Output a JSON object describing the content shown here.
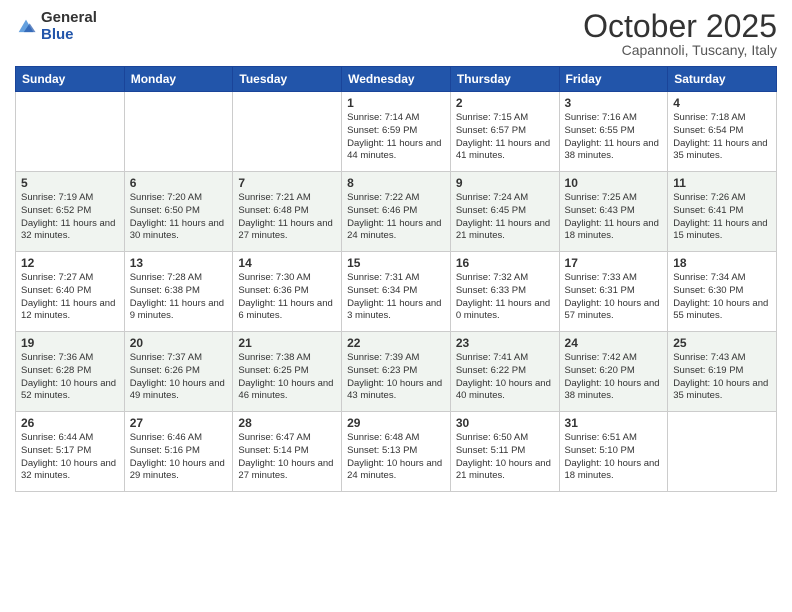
{
  "header": {
    "logo_general": "General",
    "logo_blue": "Blue",
    "month": "October 2025",
    "location": "Capannoli, Tuscany, Italy"
  },
  "weekdays": [
    "Sunday",
    "Monday",
    "Tuesday",
    "Wednesday",
    "Thursday",
    "Friday",
    "Saturday"
  ],
  "weeks": [
    {
      "shaded": false,
      "days": [
        {
          "num": "",
          "info": ""
        },
        {
          "num": "",
          "info": ""
        },
        {
          "num": "",
          "info": ""
        },
        {
          "num": "1",
          "info": "Sunrise: 7:14 AM\nSunset: 6:59 PM\nDaylight: 11 hours\nand 44 minutes."
        },
        {
          "num": "2",
          "info": "Sunrise: 7:15 AM\nSunset: 6:57 PM\nDaylight: 11 hours\nand 41 minutes."
        },
        {
          "num": "3",
          "info": "Sunrise: 7:16 AM\nSunset: 6:55 PM\nDaylight: 11 hours\nand 38 minutes."
        },
        {
          "num": "4",
          "info": "Sunrise: 7:18 AM\nSunset: 6:54 PM\nDaylight: 11 hours\nand 35 minutes."
        }
      ]
    },
    {
      "shaded": true,
      "days": [
        {
          "num": "5",
          "info": "Sunrise: 7:19 AM\nSunset: 6:52 PM\nDaylight: 11 hours\nand 32 minutes."
        },
        {
          "num": "6",
          "info": "Sunrise: 7:20 AM\nSunset: 6:50 PM\nDaylight: 11 hours\nand 30 minutes."
        },
        {
          "num": "7",
          "info": "Sunrise: 7:21 AM\nSunset: 6:48 PM\nDaylight: 11 hours\nand 27 minutes."
        },
        {
          "num": "8",
          "info": "Sunrise: 7:22 AM\nSunset: 6:46 PM\nDaylight: 11 hours\nand 24 minutes."
        },
        {
          "num": "9",
          "info": "Sunrise: 7:24 AM\nSunset: 6:45 PM\nDaylight: 11 hours\nand 21 minutes."
        },
        {
          "num": "10",
          "info": "Sunrise: 7:25 AM\nSunset: 6:43 PM\nDaylight: 11 hours\nand 18 minutes."
        },
        {
          "num": "11",
          "info": "Sunrise: 7:26 AM\nSunset: 6:41 PM\nDaylight: 11 hours\nand 15 minutes."
        }
      ]
    },
    {
      "shaded": false,
      "days": [
        {
          "num": "12",
          "info": "Sunrise: 7:27 AM\nSunset: 6:40 PM\nDaylight: 11 hours\nand 12 minutes."
        },
        {
          "num": "13",
          "info": "Sunrise: 7:28 AM\nSunset: 6:38 PM\nDaylight: 11 hours\nand 9 minutes."
        },
        {
          "num": "14",
          "info": "Sunrise: 7:30 AM\nSunset: 6:36 PM\nDaylight: 11 hours\nand 6 minutes."
        },
        {
          "num": "15",
          "info": "Sunrise: 7:31 AM\nSunset: 6:34 PM\nDaylight: 11 hours\nand 3 minutes."
        },
        {
          "num": "16",
          "info": "Sunrise: 7:32 AM\nSunset: 6:33 PM\nDaylight: 11 hours\nand 0 minutes."
        },
        {
          "num": "17",
          "info": "Sunrise: 7:33 AM\nSunset: 6:31 PM\nDaylight: 10 hours\nand 57 minutes."
        },
        {
          "num": "18",
          "info": "Sunrise: 7:34 AM\nSunset: 6:30 PM\nDaylight: 10 hours\nand 55 minutes."
        }
      ]
    },
    {
      "shaded": true,
      "days": [
        {
          "num": "19",
          "info": "Sunrise: 7:36 AM\nSunset: 6:28 PM\nDaylight: 10 hours\nand 52 minutes."
        },
        {
          "num": "20",
          "info": "Sunrise: 7:37 AM\nSunset: 6:26 PM\nDaylight: 10 hours\nand 49 minutes."
        },
        {
          "num": "21",
          "info": "Sunrise: 7:38 AM\nSunset: 6:25 PM\nDaylight: 10 hours\nand 46 minutes."
        },
        {
          "num": "22",
          "info": "Sunrise: 7:39 AM\nSunset: 6:23 PM\nDaylight: 10 hours\nand 43 minutes."
        },
        {
          "num": "23",
          "info": "Sunrise: 7:41 AM\nSunset: 6:22 PM\nDaylight: 10 hours\nand 40 minutes."
        },
        {
          "num": "24",
          "info": "Sunrise: 7:42 AM\nSunset: 6:20 PM\nDaylight: 10 hours\nand 38 minutes."
        },
        {
          "num": "25",
          "info": "Sunrise: 7:43 AM\nSunset: 6:19 PM\nDaylight: 10 hours\nand 35 minutes."
        }
      ]
    },
    {
      "shaded": false,
      "days": [
        {
          "num": "26",
          "info": "Sunrise: 6:44 AM\nSunset: 5:17 PM\nDaylight: 10 hours\nand 32 minutes."
        },
        {
          "num": "27",
          "info": "Sunrise: 6:46 AM\nSunset: 5:16 PM\nDaylight: 10 hours\nand 29 minutes."
        },
        {
          "num": "28",
          "info": "Sunrise: 6:47 AM\nSunset: 5:14 PM\nDaylight: 10 hours\nand 27 minutes."
        },
        {
          "num": "29",
          "info": "Sunrise: 6:48 AM\nSunset: 5:13 PM\nDaylight: 10 hours\nand 24 minutes."
        },
        {
          "num": "30",
          "info": "Sunrise: 6:50 AM\nSunset: 5:11 PM\nDaylight: 10 hours\nand 21 minutes."
        },
        {
          "num": "31",
          "info": "Sunrise: 6:51 AM\nSunset: 5:10 PM\nDaylight: 10 hours\nand 18 minutes."
        },
        {
          "num": "",
          "info": ""
        }
      ]
    }
  ]
}
